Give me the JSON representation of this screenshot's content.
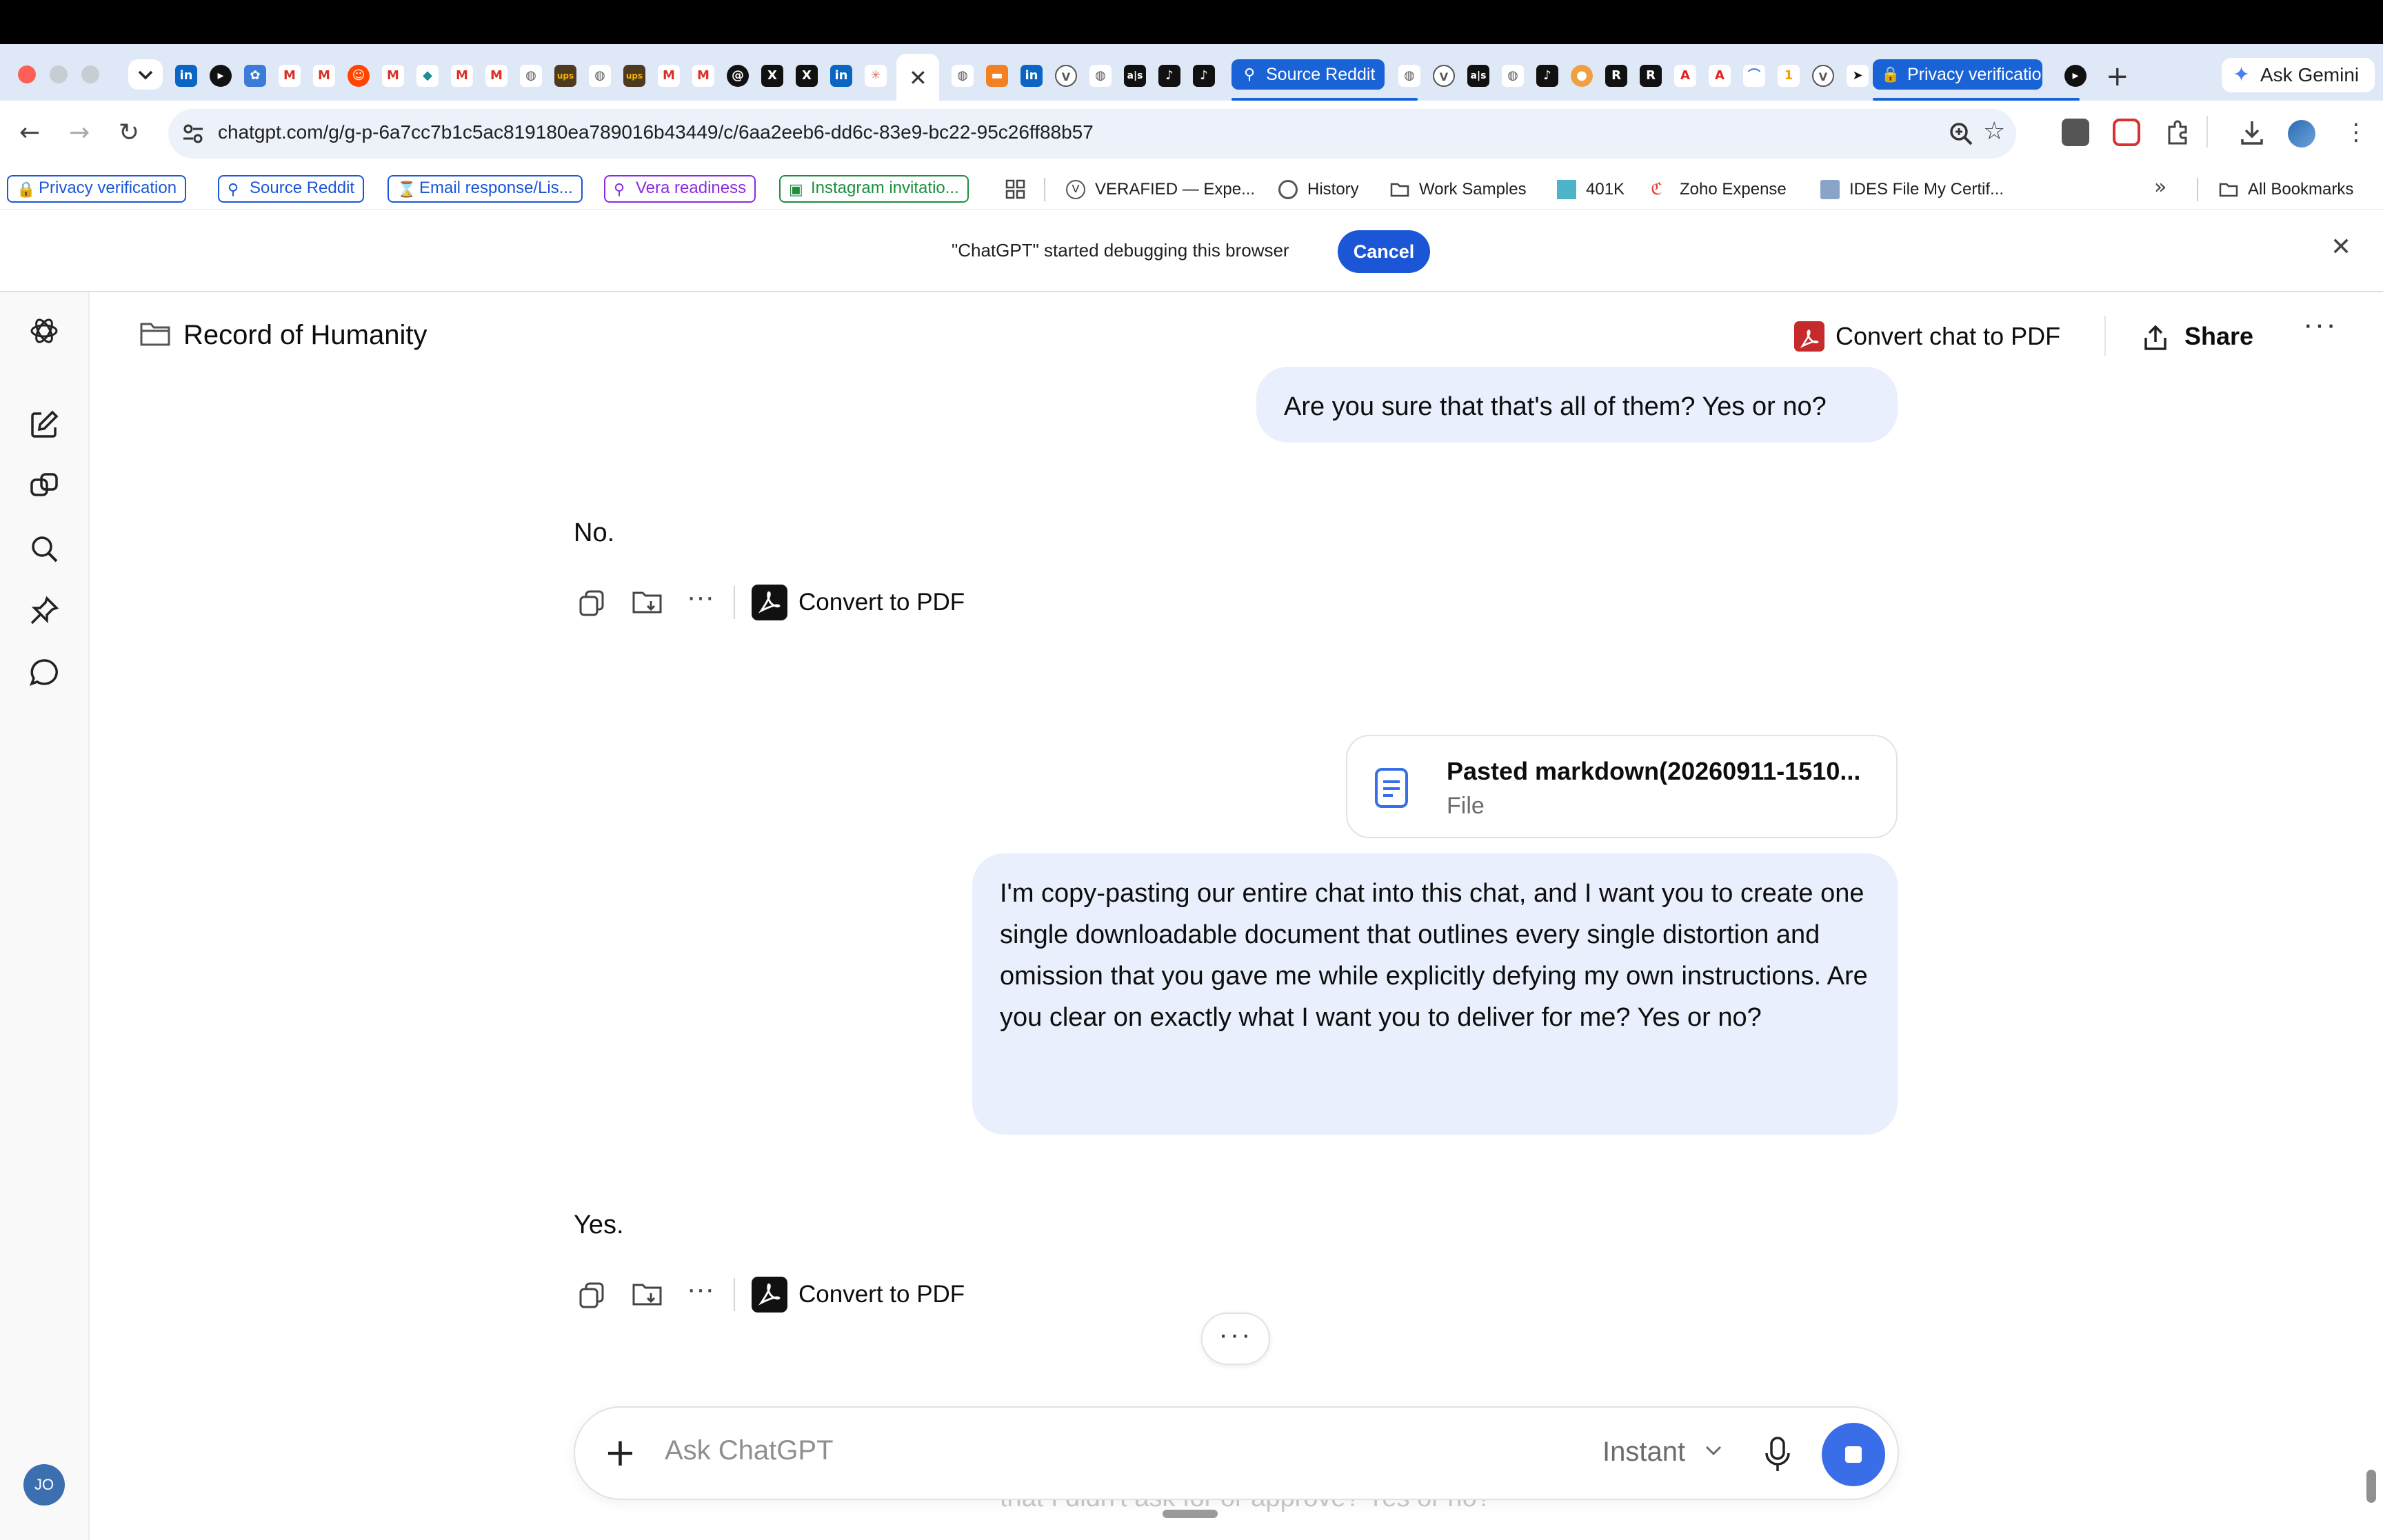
{
  "browser": {
    "tab_groups": [
      {
        "label": "Source Reddit"
      },
      {
        "label": "Privacy verificatio"
      }
    ],
    "new_tab_symbol": "+",
    "ask_gemini_label": "Ask Gemini",
    "url": "chatgpt.com/g/g-p-6a7cc7b1c5ac819180ea789016b43449/c/6aa2eeb6-dd6c-83e9-bc22-95c26ff88b57"
  },
  "bookmarks": {
    "groups": [
      {
        "label": "Privacy verification",
        "color": "#1a56d6"
      },
      {
        "label": "Source Reddit",
        "color": "#1a56d6"
      },
      {
        "label": "Email response/Lis...",
        "color": "#1a56d6"
      },
      {
        "label": "Vera readiness",
        "color": "#8a2be2"
      },
      {
        "label": "Instagram invitatio...",
        "color": "#1e8e3e"
      }
    ],
    "items": [
      {
        "label": "VERAFIED — Expe..."
      },
      {
        "label": "History"
      },
      {
        "label": "Work Samples"
      },
      {
        "label": "401K"
      },
      {
        "label": "Zoho Expense"
      },
      {
        "label": "IDES File My Certif..."
      }
    ],
    "all_bookmarks_label": "All Bookmarks"
  },
  "infobar": {
    "message": "\"ChatGPT\" started debugging this browser",
    "cancel_label": "Cancel"
  },
  "sidebar": {
    "user_initials": "JO"
  },
  "header": {
    "project_name": "Record of Humanity",
    "convert_chat_label": "Convert chat to PDF",
    "share_label": "Share"
  },
  "messages": [
    {
      "role": "user",
      "text": "Are you sure that that's all of them? Yes or no?"
    },
    {
      "role": "assistant",
      "text": "No.",
      "convert_label": "Convert to PDF"
    },
    {
      "role": "user",
      "file": {
        "name": "Pasted markdown(20260911-1510...",
        "type": "File"
      },
      "text": "I'm copy-pasting our entire chat into this chat, and I want you to create one single downloadable document that outlines every single distortion and omission that you gave me while explicitly defying my own instructions. Are you clear on exactly what I want you to deliver for me? Yes or no?"
    },
    {
      "role": "assistant",
      "text": "Yes.",
      "convert_label": "Convert to PDF"
    }
  ],
  "composer": {
    "placeholder": "Ask ChatGPT",
    "model_label": "Instant",
    "faded_draft": "that I didn't ask for or approve? Yes or no?"
  }
}
